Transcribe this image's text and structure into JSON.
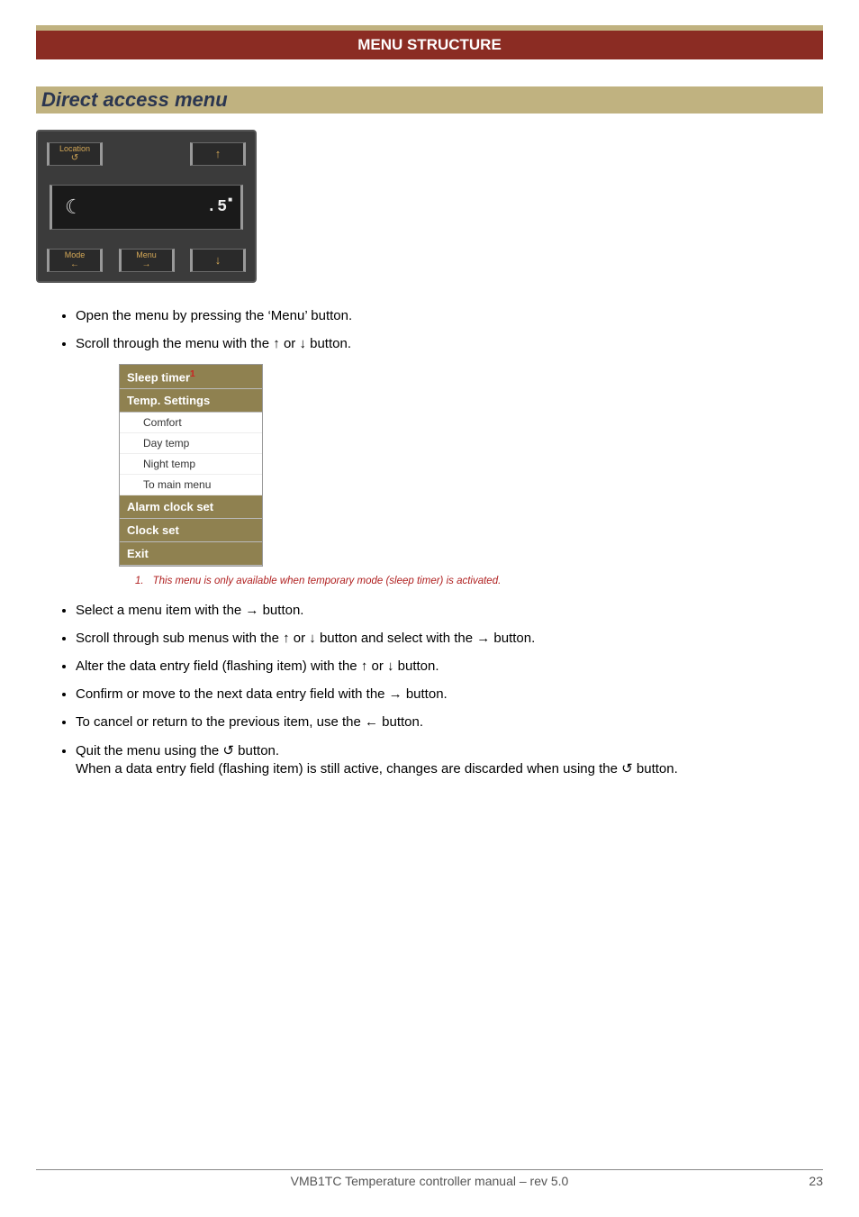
{
  "banner": {
    "title": "MENU STRUCTURE"
  },
  "section": {
    "title": "Direct access menu"
  },
  "device": {
    "btn_location": "Location",
    "btn_up": "↑",
    "btn_mode": "Mode",
    "btn_menu": "Menu",
    "btn_down": "↓",
    "lcd_temp_major": ".5",
    "back_glyph": "↺",
    "left_glyph": "←",
    "right_glyph": "→"
  },
  "bul": {
    "b1": "Open the menu by pressing the ‘Menu’ button.",
    "b2": "Scroll through the menu with the ↑ or ↓ button.",
    "b3": "Select a menu item with the → button.",
    "b4": "Scroll through sub menus with the ↑ or ↓ button and select with the → button.",
    "b5": "Alter the data entry field (flashing item) with the ↑ or ↓ button.",
    "b6": "Confirm or move to the next data entry field with the → button.",
    "b7": "To cancel or return to the previous item, use the ← button.",
    "b8a": "Quit the menu using the ↺ button.",
    "b8b": "When a data entry field (flashing item) is still active, changes are discarded when using the ↺ button."
  },
  "menu": {
    "sleep": "Sleep timer",
    "sleep_sup": "1",
    "temp": "Temp. Settings",
    "sub1": "Comfort",
    "sub2": "Day temp",
    "sub3": "Night temp",
    "sub4": "To main menu",
    "alarm": "Alarm clock set",
    "clock": "Clock set",
    "exit": "Exit"
  },
  "footnote": {
    "num": "1.",
    "text": "This menu is only available when temporary mode (sleep timer) is activated."
  },
  "footer": {
    "text": "VMB1TC Temperature controller manual – rev 5.0",
    "page": "23"
  }
}
